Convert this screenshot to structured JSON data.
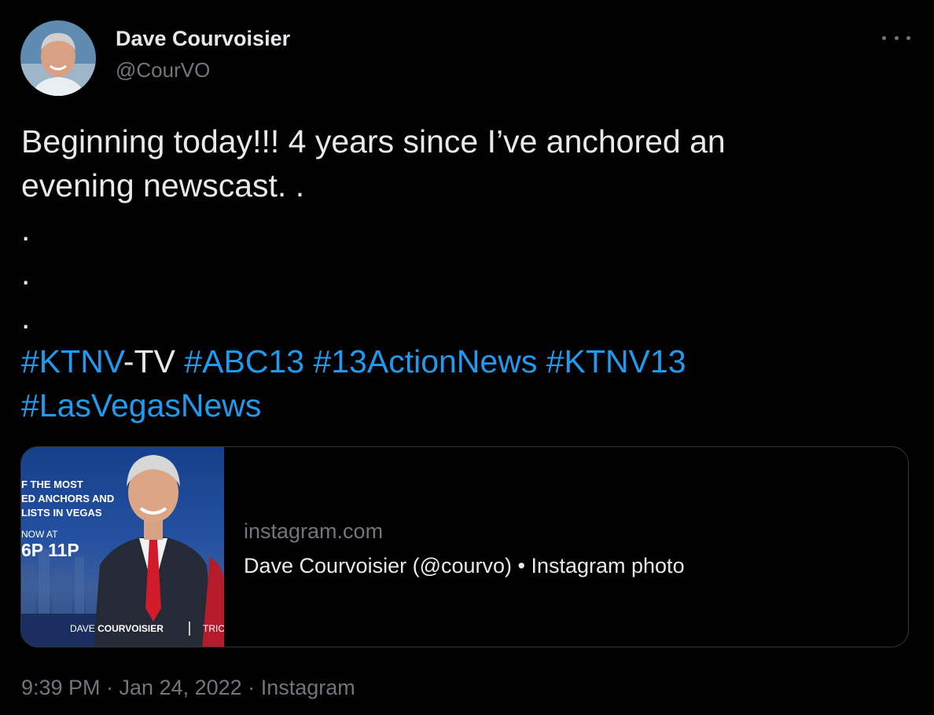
{
  "tweet": {
    "author_name": "Dave Courvoisier",
    "author_handle": "@CourVO",
    "text_line1": "Beginning today!!!  4 years since I’ve anchored an",
    "text_line2": "evening newscast. .",
    "dots": [
      ".",
      ".",
      "."
    ],
    "hashtags_line1": [
      {
        "text": "#KTNV",
        "link": true
      },
      {
        "text": "-TV ",
        "link": false
      },
      {
        "text": "#ABC13",
        "link": true
      },
      {
        "text": " ",
        "link": false
      },
      {
        "text": "#13ActionNews",
        "link": true
      },
      {
        "text": " ",
        "link": false
      },
      {
        "text": "#KTNV13",
        "link": true
      }
    ],
    "hashtag_line2": "#LasVegasNews",
    "timestamp": "9:39 PM · Jan 24, 2022 · ",
    "source": "Instagram"
  },
  "card": {
    "domain": "instagram.com",
    "title": "Dave Courvoisier (@courvo) • Instagram photo",
    "image_text": {
      "line1": "F THE MOST",
      "line2": "ED ANCHORS AND",
      "line3": "LISTS IN VEGAS",
      "now_at": "NOW AT",
      "times": "6P 11P",
      "name_plain": "DAVE",
      "name_bold": "COURVOISIER",
      "cut": "TRIC"
    }
  },
  "colors": {
    "background": "#000000",
    "text": "#e7e9ea",
    "secondary": "#71767b",
    "link": "#1d9bf0",
    "card_border": "#333639"
  },
  "icons": {
    "more": "more-horizontal-icon"
  }
}
